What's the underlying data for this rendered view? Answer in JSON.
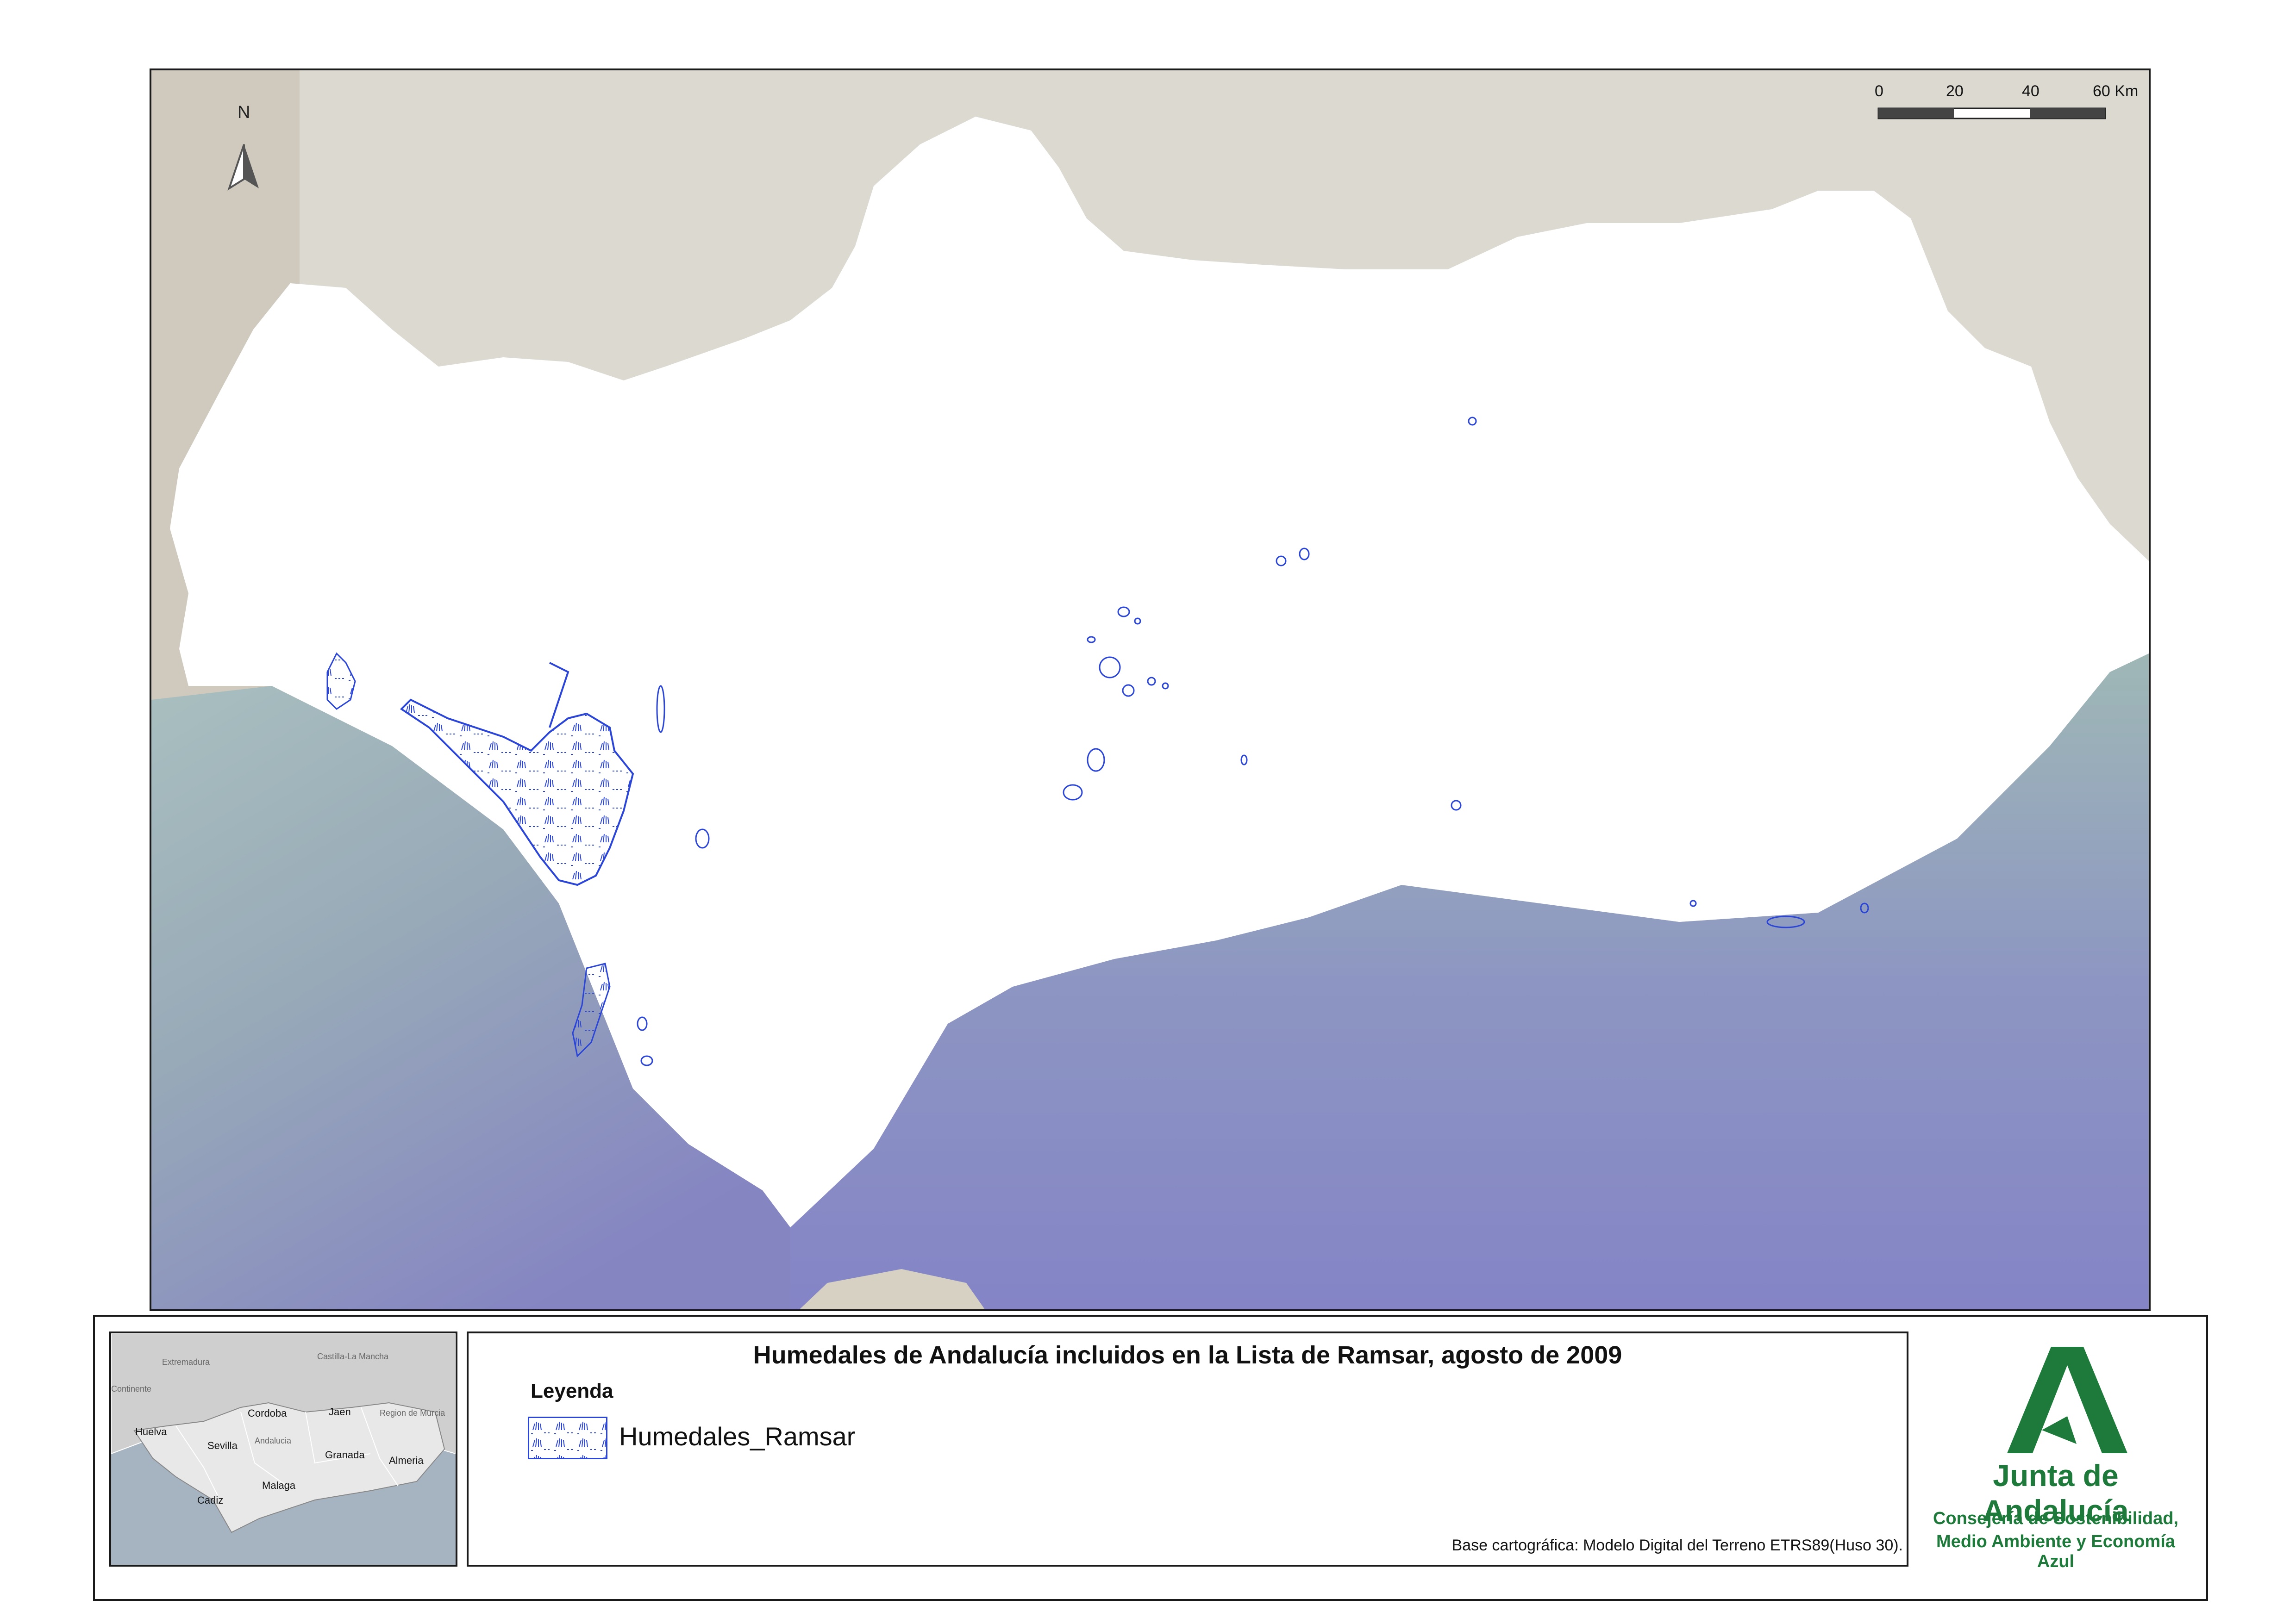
{
  "map": {
    "north_label": "N",
    "scale_labels": [
      "0",
      "20",
      "40",
      "60 Km"
    ]
  },
  "panel": {
    "title": "Humedales de Andalucía incluidos en la Lista de Ramsar, agosto de 2009",
    "legend_heading": "Leyenda",
    "legend_item": "Humedales_Ramsar",
    "base_note": "Base cartográfica: Modelo Digital del Terreno ETRS89(Huso 30)."
  },
  "inset": {
    "labels": [
      "Extremadura",
      "Castilla-La Mancha",
      "Continente",
      "Region de Murcia",
      "Huelva",
      "Sevilla",
      "Cordoba",
      "Jaen",
      "Andalucia",
      "Granada",
      "Almeria",
      "Cadiz",
      "Malaga"
    ]
  },
  "logo": {
    "name": "Junta de Andalucía",
    "dept_line1": "Consejería de Sostenibilidad,",
    "dept_line2": "Medio Ambiente y Economía Azul"
  },
  "colors": {
    "land_relief": "#d9d6cc",
    "sea": "#8fa3b3",
    "deep_sea": "#8080c0",
    "wetland_outline": "#2b46d6",
    "brand_green": "#1e7a3a"
  }
}
